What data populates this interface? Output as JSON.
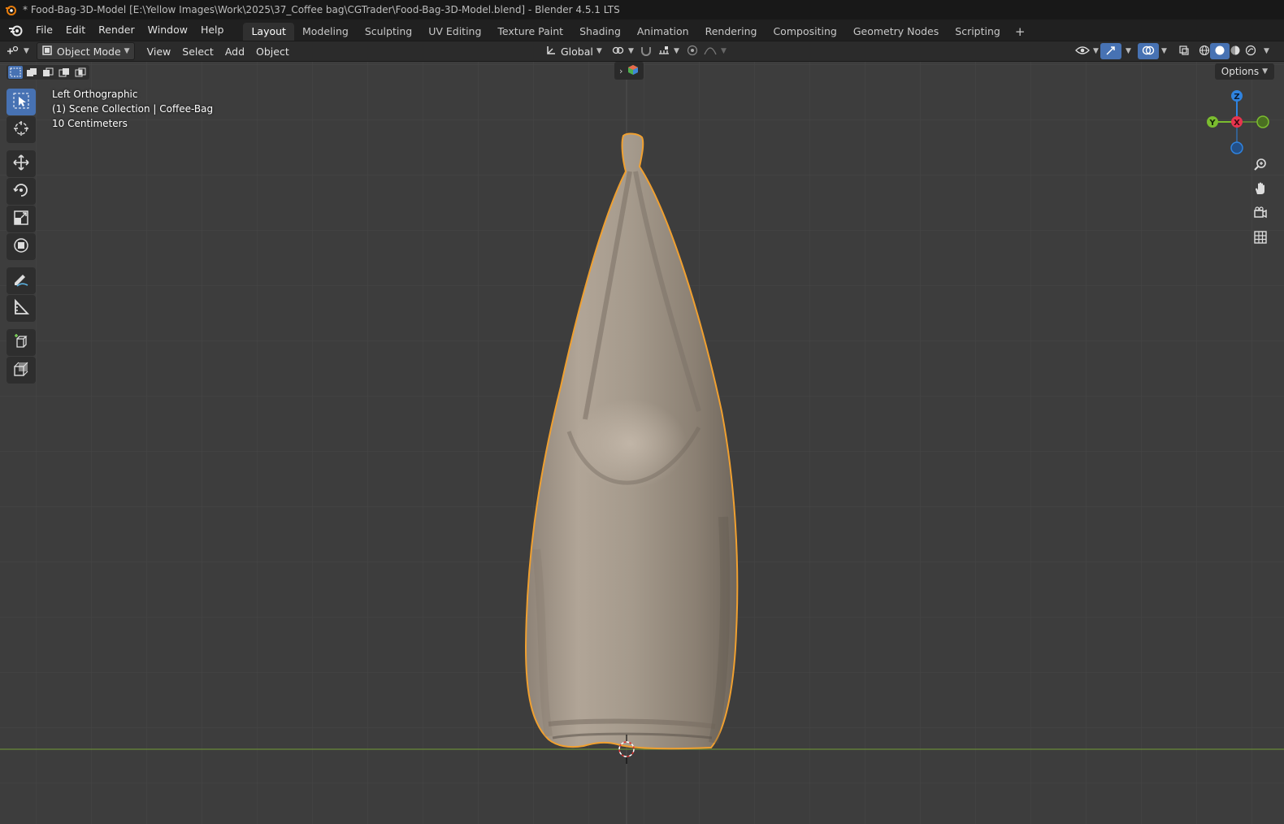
{
  "window": {
    "title": "* Food-Bag-3D-Model [E:\\Yellow Images\\Work\\2025\\37_Coffee bag\\CGTrader\\Food-Bag-3D-Model.blend] - Blender 4.5.1 LTS"
  },
  "menu": {
    "items": [
      "File",
      "Edit",
      "Render",
      "Window",
      "Help"
    ]
  },
  "workspaces": {
    "tabs": [
      "Layout",
      "Modeling",
      "Sculpting",
      "UV Editing",
      "Texture Paint",
      "Shading",
      "Animation",
      "Rendering",
      "Compositing",
      "Geometry Nodes",
      "Scripting"
    ],
    "active": "Layout",
    "add_symbol": "+"
  },
  "header": {
    "mode": "Object Mode",
    "menus": [
      "View",
      "Select",
      "Add",
      "Object"
    ],
    "orientation": "Global"
  },
  "viewport": {
    "view_name": "Left Orthographic",
    "collection": "(1) Scene Collection | Coffee-Bag",
    "scale": "10 Centimeters",
    "options_label": "Options",
    "background": "#3d3d3d",
    "grid_color": "#474747",
    "floor_line_color": "#6a8a3a",
    "selection_outline": "#f0a030",
    "object_color": "#a89b8d"
  },
  "gizmo": {
    "x_label": "X",
    "y_label": "Y",
    "z_label": "Z",
    "x_color": "#e8344e",
    "y_color": "#7bbd2f",
    "z_color": "#2f83e0"
  },
  "colors": {
    "accent": "#4772b3"
  }
}
